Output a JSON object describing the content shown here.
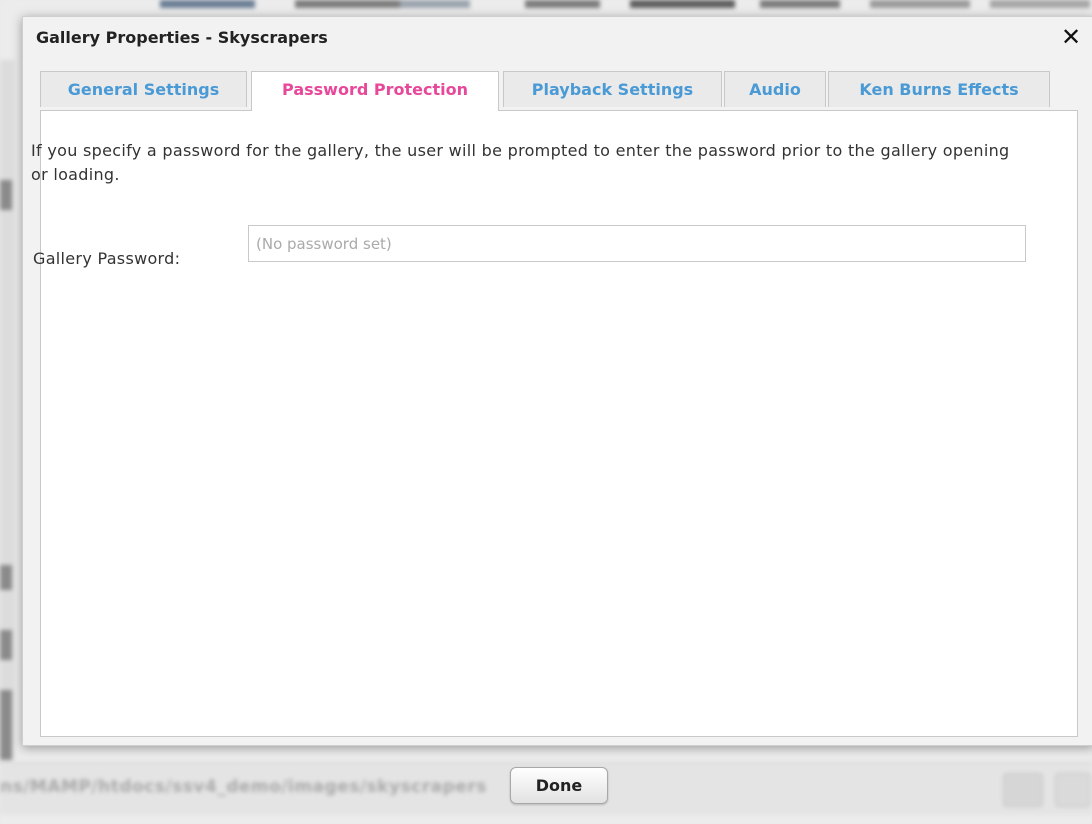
{
  "dialog": {
    "title": "Gallery Properties - Skyscrapers",
    "close_symbol": "✕",
    "close_icon": "close-icon"
  },
  "tabs": [
    {
      "label": "General Settings",
      "active": false
    },
    {
      "label": "Password Protection",
      "active": true
    },
    {
      "label": "Playback Settings",
      "active": false
    },
    {
      "label": "Audio",
      "active": false
    },
    {
      "label": "Ken Burns Effects",
      "active": false
    }
  ],
  "password_panel": {
    "description": "If you specify a password for the gallery, the user will be prompted to enter the password prior to the gallery opening or loading.",
    "field_label": "Gallery Password:",
    "field_value": "",
    "field_placeholder": "(No password set)"
  },
  "footer": {
    "done_label": "Done"
  },
  "background": {
    "path_text": "ns/MAMP/htdocs/ssv4_demo/images/skyscrapers"
  },
  "colors": {
    "active_tab": "#e8489a",
    "inactive_tab": "#4a9ad6"
  }
}
